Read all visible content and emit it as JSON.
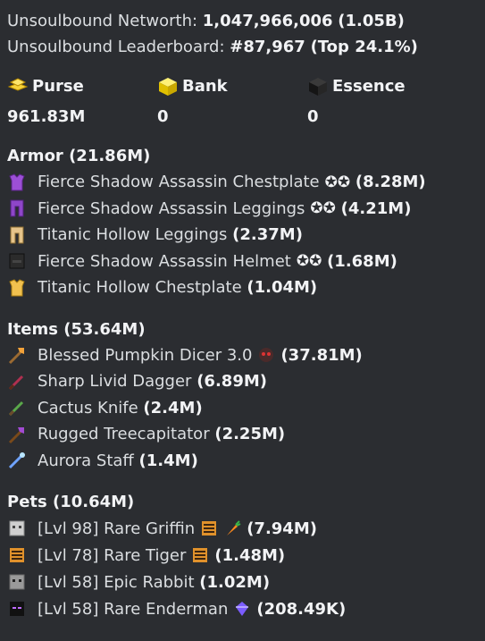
{
  "header": {
    "networth_label": "Unsoulbound Networth:",
    "networth_value": "1,047,966,006",
    "networth_short": "(1.05B)",
    "leaderboard_label": "Unsoulbound Leaderboard:",
    "leaderboard_value": "#87,967",
    "leaderboard_top": "(Top 24.1%)"
  },
  "stats": [
    {
      "label": "Purse",
      "value": "961.83M",
      "icon": "gold-ingots-icon"
    },
    {
      "label": "Bank",
      "value": "0",
      "icon": "gold-block-icon"
    },
    {
      "label": "Essence",
      "value": "0",
      "icon": "black-cube-icon"
    }
  ],
  "armor": {
    "title": "Armor (21.86M)",
    "items": [
      {
        "name": "Fierce Shadow Assassin Chestplate",
        "stars": "✪✪",
        "value": "(8.28M)",
        "icon": "purple-chestplate-icon"
      },
      {
        "name": "Fierce Shadow Assassin Leggings",
        "stars": "✪✪",
        "value": "(4.21M)",
        "icon": "purple-leggings-icon"
      },
      {
        "name": "Titanic Hollow Leggings",
        "stars": "",
        "value": "(2.37M)",
        "icon": "hollow-leggings-icon"
      },
      {
        "name": "Fierce Shadow Assassin Helmet",
        "stars": "✪✪",
        "value": "(1.68M)",
        "icon": "dark-helmet-icon"
      },
      {
        "name": "Titanic Hollow Chestplate",
        "stars": "",
        "value": "(1.04M)",
        "icon": "gold-chestplate-icon"
      }
    ]
  },
  "items": {
    "title": "Items (53.64M)",
    "items": [
      {
        "name": "Blessed Pumpkin Dicer 3.0",
        "extra_icon": "spider-icon",
        "value": "(37.81M)",
        "icon": "axe-icon"
      },
      {
        "name": "Sharp Livid Dagger",
        "value": "(6.89M)",
        "icon": "dagger-icon"
      },
      {
        "name": "Cactus Knife",
        "value": "(2.4M)",
        "icon": "knife-icon"
      },
      {
        "name": "Rugged Treecapitator",
        "value": "(2.25M)",
        "icon": "purple-axe-icon"
      },
      {
        "name": "Aurora Staff",
        "value": "(1.4M)",
        "icon": "staff-icon"
      }
    ]
  },
  "pets": {
    "title": "Pets (10.64M)",
    "items": [
      {
        "name": "[Lvl 98] Rare Griffin",
        "value": "(7.94M)",
        "icon": "griffin-icon",
        "extras": [
          "tiger-icon",
          "carrot-icon"
        ]
      },
      {
        "name": "[Lvl 78] Rare Tiger",
        "value": "(1.48M)",
        "icon": "tiger-icon",
        "extras": [
          "tiger-icon"
        ]
      },
      {
        "name": "[Lvl 58] Epic Rabbit",
        "value": "(1.02M)",
        "icon": "rabbit-icon",
        "extras": []
      },
      {
        "name": "[Lvl 58] Rare Enderman",
        "value": "(208.49K)",
        "icon": "enderman-icon",
        "extras": [
          "purple-gem-icon"
        ]
      }
    ]
  },
  "colors": {
    "background": "#2b2d31",
    "text": "#dbdee1",
    "bold_text": "#f2f3f5"
  }
}
